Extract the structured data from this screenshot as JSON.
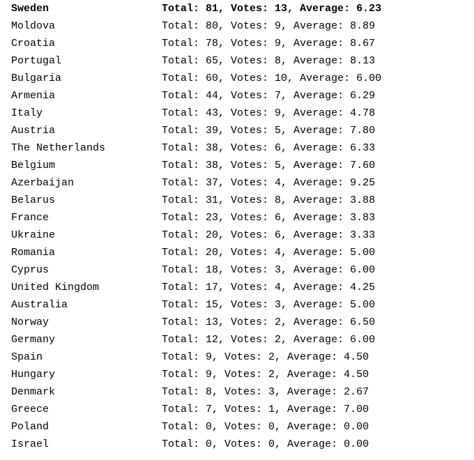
{
  "labels": {
    "total": "Total:",
    "votes": "Votes:",
    "average": "Average:"
  },
  "rows": [
    {
      "country": "Sweden",
      "total": 81,
      "votes": 13,
      "average": "6.23",
      "bold": true
    },
    {
      "country": "Moldova",
      "total": 80,
      "votes": 9,
      "average": "8.89",
      "bold": false
    },
    {
      "country": "Croatia",
      "total": 78,
      "votes": 9,
      "average": "8.67",
      "bold": false
    },
    {
      "country": "Portugal",
      "total": 65,
      "votes": 8,
      "average": "8.13",
      "bold": false
    },
    {
      "country": "Bulgaria",
      "total": 60,
      "votes": 10,
      "average": "6.00",
      "bold": false
    },
    {
      "country": "Armenia",
      "total": 44,
      "votes": 7,
      "average": "6.29",
      "bold": false
    },
    {
      "country": "Italy",
      "total": 43,
      "votes": 9,
      "average": "4.78",
      "bold": false
    },
    {
      "country": "Austria",
      "total": 39,
      "votes": 5,
      "average": "7.80",
      "bold": false
    },
    {
      "country": "The Netherlands",
      "total": 38,
      "votes": 6,
      "average": "6.33",
      "bold": false
    },
    {
      "country": "Belgium",
      "total": 38,
      "votes": 5,
      "average": "7.60",
      "bold": false
    },
    {
      "country": "Azerbaijan",
      "total": 37,
      "votes": 4,
      "average": "9.25",
      "bold": false
    },
    {
      "country": "Belarus",
      "total": 31,
      "votes": 8,
      "average": "3.88",
      "bold": false
    },
    {
      "country": "France",
      "total": 23,
      "votes": 6,
      "average": "3.83",
      "bold": false
    },
    {
      "country": "Ukraine",
      "total": 20,
      "votes": 6,
      "average": "3.33",
      "bold": false
    },
    {
      "country": "Romania",
      "total": 20,
      "votes": 4,
      "average": "5.00",
      "bold": false
    },
    {
      "country": "Cyprus",
      "total": 18,
      "votes": 3,
      "average": "6.00",
      "bold": false
    },
    {
      "country": "United Kingdom",
      "total": 17,
      "votes": 4,
      "average": "4.25",
      "bold": false
    },
    {
      "country": "Australia",
      "total": 15,
      "votes": 3,
      "average": "5.00",
      "bold": false
    },
    {
      "country": "Norway",
      "total": 13,
      "votes": 2,
      "average": "6.50",
      "bold": false
    },
    {
      "country": "Germany",
      "total": 12,
      "votes": 2,
      "average": "6.00",
      "bold": false
    },
    {
      "country": "Spain",
      "total": 9,
      "votes": 2,
      "average": "4.50",
      "bold": false
    },
    {
      "country": "Hungary",
      "total": 9,
      "votes": 2,
      "average": "4.50",
      "bold": false
    },
    {
      "country": "Denmark",
      "total": 8,
      "votes": 3,
      "average": "2.67",
      "bold": false
    },
    {
      "country": "Greece",
      "total": 7,
      "votes": 1,
      "average": "7.00",
      "bold": false
    },
    {
      "country": "Poland",
      "total": 0,
      "votes": 0,
      "average": "0.00",
      "bold": false
    },
    {
      "country": "Israel",
      "total": 0,
      "votes": 0,
      "average": "0.00",
      "bold": false
    }
  ]
}
